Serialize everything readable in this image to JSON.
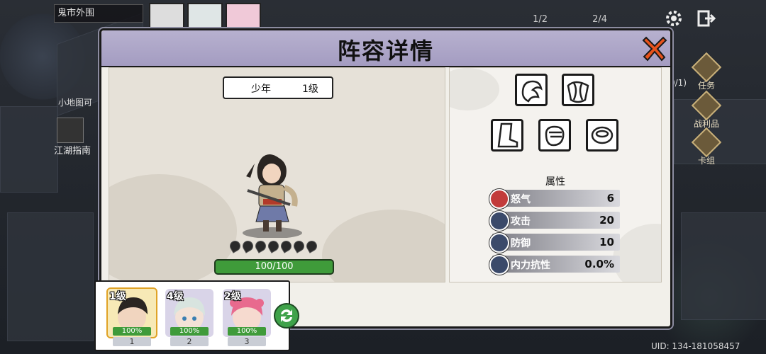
{
  "hud": {
    "location": "鬼市外围",
    "counter1": "1/2",
    "counter2": "2/4",
    "minimap_label": "小地图可",
    "guide_label": "江湖指南",
    "quest_partial": "0/1)",
    "nav": [
      "任务",
      "战利品",
      "卡组"
    ]
  },
  "modal": {
    "title": "阵容详情",
    "hero": {
      "type": "少年",
      "level": "1级",
      "rage_dots": 7,
      "hp": "100/100",
      "hp_ratio": 1.0
    },
    "equipment": [
      "head-icon",
      "chest-icon",
      "boots-icon",
      "glove-icon",
      "ring-icon"
    ],
    "attributes_title": "属性",
    "attributes": [
      {
        "icon": "rage-icon",
        "name": "怒气",
        "value": "6",
        "color": "#c23b3b"
      },
      {
        "icon": "attack-icon",
        "name": "攻击",
        "value": "20",
        "color": "#3b5ca8"
      },
      {
        "icon": "defense-icon",
        "name": "防御",
        "value": "10",
        "color": "#3b5ca8"
      },
      {
        "icon": "resist-icon",
        "name": "内力抗性",
        "value": "0.0%",
        "color": "#3b5ca8"
      }
    ]
  },
  "team": [
    {
      "level": "1级",
      "hp": "100%",
      "slot": "1",
      "selected": true
    },
    {
      "level": "4级",
      "hp": "100%",
      "slot": "2",
      "selected": false
    },
    {
      "level": "2级",
      "hp": "100%",
      "slot": "3",
      "selected": false
    }
  ],
  "uid": "UID: 134-181058457",
  "colors": {
    "header": "#a49cc1",
    "hp_green": "#3f9b3a",
    "close": "#e8531c"
  }
}
